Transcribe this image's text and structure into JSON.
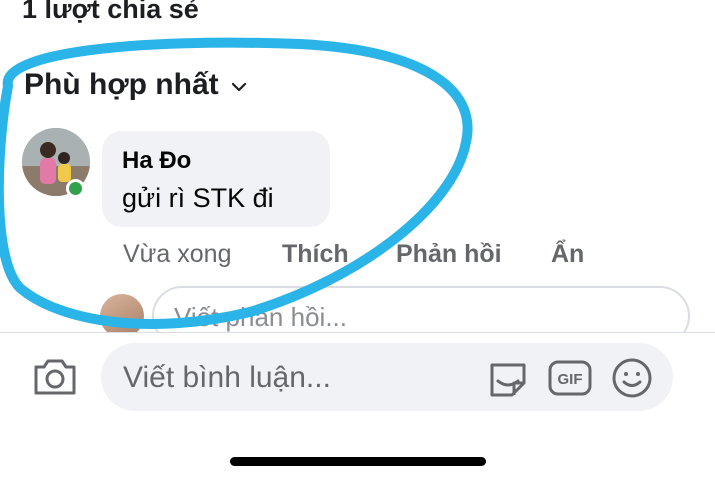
{
  "header": {
    "share_count": "1 lượt chia sẻ"
  },
  "sort": {
    "label": "Phù hợp nhất"
  },
  "comment": {
    "author": "Ha Đo",
    "text": "gửi rì STK đi",
    "time": "Vừa xong",
    "like_label": "Thích",
    "reply_label": "Phản hồi",
    "hide_label": "Ẩn",
    "online": true
  },
  "reply_box": {
    "placeholder": "Viết phản hồi..."
  },
  "composer": {
    "placeholder": "Viết bình luận...",
    "gif_label": "GIF",
    "icons": [
      "camera-icon",
      "sticker-icon",
      "gif-icon",
      "emoji-icon"
    ]
  },
  "colors": {
    "annotation": "#2ab4e8",
    "online": "#31a24c",
    "bubble": "#f0f2f5",
    "secondary_text": "#65676b"
  }
}
